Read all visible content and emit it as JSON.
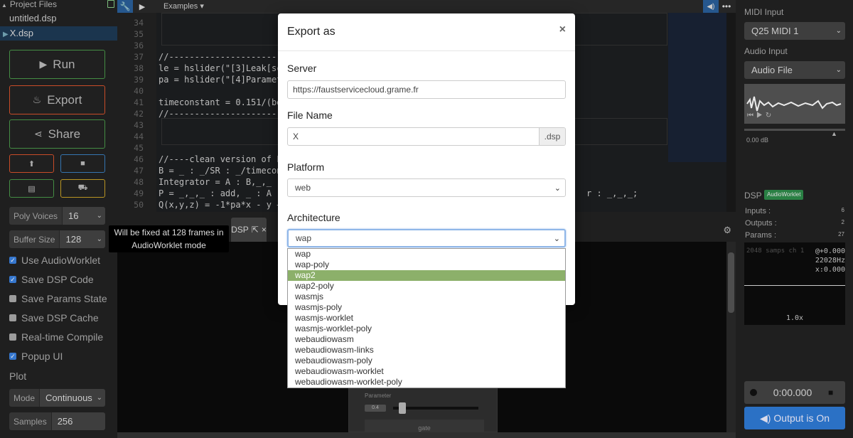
{
  "topbar": {
    "examples_label": "Examples"
  },
  "project": {
    "title": "Project Files",
    "files": [
      "untitled.dsp",
      "X.dsp"
    ]
  },
  "buttons": {
    "run": "Run",
    "export": "Export",
    "share": "Share"
  },
  "poly_voices": {
    "label": "Poly Voices",
    "value": "16"
  },
  "buffer_size": {
    "label": "Buffer Size",
    "value": "128"
  },
  "tooltip": {
    "text": "Will be fixed at 128 frames in AudioWorklet mode"
  },
  "options": [
    {
      "label": "Use AudioWorklet",
      "checked": true
    },
    {
      "label": "Save DSP Code",
      "checked": true
    },
    {
      "label": "Save Params State",
      "checked": false
    },
    {
      "label": "Save DSP Cache",
      "checked": false
    },
    {
      "label": "Real-time Compile",
      "checked": false
    },
    {
      "label": "Popup UI",
      "checked": true
    }
  ],
  "plot": {
    "heading": "Plot",
    "mode_label": "Mode",
    "mode_value": "Continuous",
    "samples_label": "Samples",
    "samples_value": "256"
  },
  "editor": {
    "line_numbers": [
      "34",
      "35",
      "36",
      "37",
      "38",
      "39",
      "40",
      "41",
      "42",
      "43",
      "44",
      "45",
      "46",
      "47",
      "48",
      "49",
      "50"
    ],
    "lines": {
      "l37": "//-------------------------",
      "l38": "le = hslider(\"[3]Leak[sc",
      "l39": "pa = hslider(\"[4]Paramet",
      "l41": "timeconstant = 0.151/(be",
      "l42": "//-------------------------",
      "l46": "//----clean version of F",
      "l47": "B = _ : _/SR : _/timecon",
      "l48": "Integrator = A : B,_,_ :",
      "l49": "P = _,_,_ : add, _ : A :",
      "l49b": "r : _,_,_;",
      "l50": "Q(x,y,z) = -1*pa*x - y +"
    }
  },
  "bottom_tab": {
    "label": "DSP"
  },
  "faust_ui": {
    "param_label": "Parameter",
    "param_value": "0.4",
    "gate_label": "gate"
  },
  "right": {
    "midi_input_label": "MIDI Input",
    "midi_input_value": "Q25 MIDI 1",
    "audio_input_label": "Audio Input",
    "audio_input_value": "Audio File",
    "volume_db": "0.00 dB",
    "dsp_label": "DSP",
    "dsp_badge": "AudioWorklet",
    "inputs_label": "Inputs :",
    "inputs_value": "6",
    "outputs_label": "Outputs :",
    "outputs_value": "2",
    "params_label": "Params :",
    "params_value": "27",
    "scope_header": "2048 samps  ch 1",
    "scope_r1": "@+0.000",
    "scope_r2": "22028Hz",
    "scope_r3": "x:0.000",
    "scope_zoom": "1.0x",
    "rec_time": "0:00.000",
    "output_label": "Output is On"
  },
  "modal": {
    "title": "Export as",
    "server_label": "Server",
    "server_value": "https://faustservicecloud.grame.fr",
    "filename_label": "File Name",
    "filename_value": "X",
    "filename_ext": ".dsp",
    "platform_label": "Platform",
    "platform_value": "web",
    "arch_label": "Architecture",
    "arch_value": "wap",
    "arch_options": [
      "wap",
      "wap-poly",
      "wap2",
      "wap2-poly",
      "wasmjs",
      "wasmjs-poly",
      "wasmjs-worklet",
      "wasmjs-worklet-poly",
      "webaudiowasm",
      "webaudiowasm-links",
      "webaudiowasm-poly",
      "webaudiowasm-worklet",
      "webaudiowasm-worklet-poly"
    ],
    "arch_highlighted": "wap2"
  },
  "colors": {
    "accent_blue": "#2f7bd6",
    "run_green": "#4a9a4a",
    "export_orange": "#d9532c",
    "highlight_green": "#8cb06a"
  }
}
